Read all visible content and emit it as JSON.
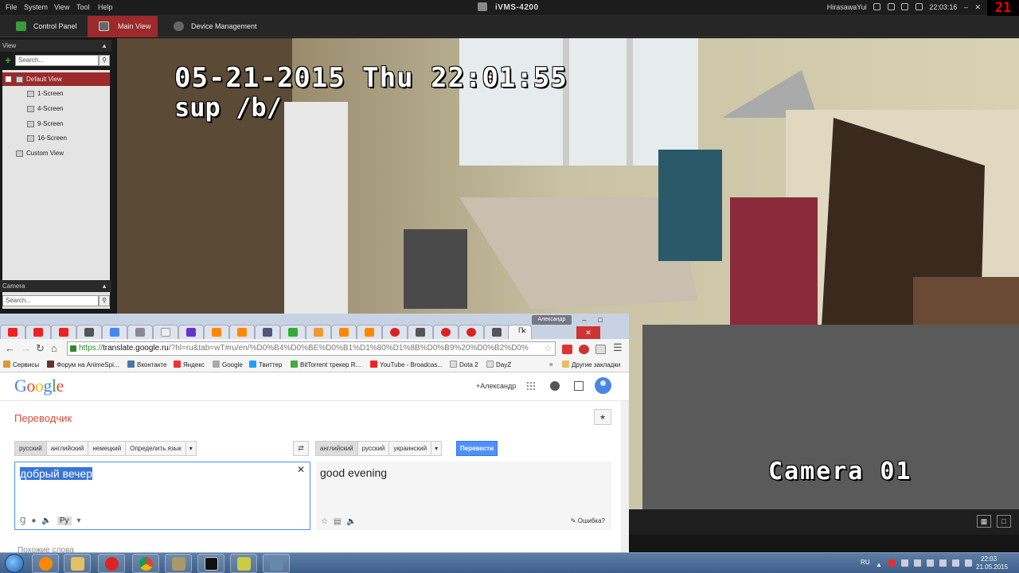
{
  "menubar": {
    "items": [
      "File",
      "System",
      "View",
      "Tool",
      "Help"
    ],
    "app_title": "iVMS-4200",
    "user": "HirasawaYui",
    "time": "22:03:16",
    "red_digits": "21"
  },
  "tabs": {
    "control_panel": "Control Panel",
    "main_view": "Main View",
    "device_management": "Device Management"
  },
  "view_panel": {
    "title": "View",
    "search_placeholder": "Search...",
    "tree": [
      {
        "label": "Default View",
        "selected": true
      },
      {
        "label": "1-Screen"
      },
      {
        "label": "4-Screen"
      },
      {
        "label": "9-Screen"
      },
      {
        "label": "16-Screen"
      },
      {
        "label": "Custom View"
      }
    ]
  },
  "camera_panel": {
    "title": "Camera",
    "search_placeholder": "Search..."
  },
  "camera_osd": {
    "date_line": "05-21-2015 Thu 22:01:55",
    "sub_line": "sup /b/",
    "camera_name": "Camera 01"
  },
  "chrome": {
    "user_badge": "Александр",
    "tab_active_label": "П",
    "url_https": "https://",
    "url_host": "translate.google.ru",
    "url_rest": "/?hl=ru&tab=wT#ru/en/%D0%B4%D0%BE%D0%B1%D1%80%D1%8B%D0%B9%20%D0%B2%D0%",
    "bookmarks": [
      "Сервисы",
      "Форум на AnimeSpi...",
      "Вконтакте",
      "Яндекс",
      "Google",
      "Твиттер",
      "BitTorrent трекер R...",
      "YouTube - Broadcas...",
      "Dota 2",
      "DayZ"
    ],
    "other_bookmarks": "Другие закладки",
    "more": "»"
  },
  "translate": {
    "logo_letters": [
      "G",
      "o",
      "o",
      "g",
      "l",
      "e"
    ],
    "logo_colors": [
      "#4285f4",
      "#ea4335",
      "#fbbc05",
      "#4285f4",
      "#34a853",
      "#ea4335"
    ],
    "user_link": "+Александр",
    "title": "Переводчик",
    "source_langs": [
      "русский",
      "английский",
      "немецкий",
      "Определить язык"
    ],
    "target_langs": [
      "английский",
      "русский",
      "украинский"
    ],
    "translate_button": "Перевести",
    "source_text": "добрый вечер",
    "target_text": "good evening",
    "lang_tag": "Ру",
    "error_link": "Ошибка?",
    "similar_words": "Похожие слова"
  },
  "taskbar": {
    "lang": "RU",
    "time": "22:03",
    "date": "21.05.2015"
  }
}
